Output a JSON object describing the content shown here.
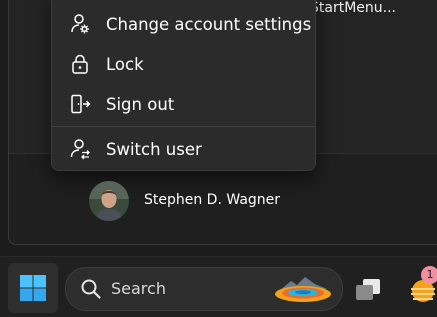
{
  "background_app": {
    "label": "StartMenu..."
  },
  "account_menu": {
    "items": [
      {
        "label": "Change account settings",
        "icon": "person-gear-icon"
      },
      {
        "label": "Lock",
        "icon": "lock-icon"
      },
      {
        "label": "Sign out",
        "icon": "sign-out-icon"
      },
      {
        "label": "Switch user",
        "icon": "switch-user-icon"
      }
    ]
  },
  "user": {
    "name": "Stephen D. Wagner"
  },
  "taskbar": {
    "search_placeholder": "Search",
    "widget_badge": "1"
  },
  "colors": {
    "menu_bg": "#2b2b2b",
    "panel_bg": "#242424",
    "taskbar_bg": "#202020",
    "windows_blue": "#4cc2ff"
  }
}
